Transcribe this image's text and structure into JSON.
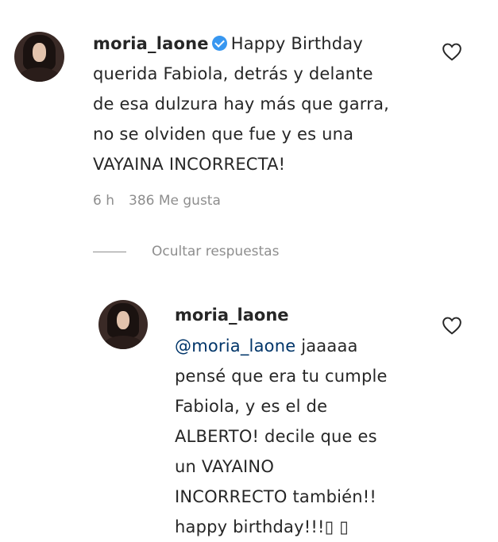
{
  "comment": {
    "username": "moria_laone",
    "text_lines": [
      "Happy Birthday",
      "querida Fabiola, detrás y delante",
      "de esa dulzura hay más que garra,",
      "no se olviden que fue y es una",
      "VAYAINA INCORRECTA!"
    ],
    "time": "6 h",
    "likes": "386 Me gusta"
  },
  "hide_replies_label": "Ocultar respuestas",
  "reply": {
    "username": "moria_laone",
    "mention": "@moria_laone",
    "text_lines": [
      " jaaaaa",
      "pensé que era tu cumple",
      "Fabiola, y es el de",
      "ALBERTO! decile que es",
      "un VAYAINO",
      "INCORRECTO también!!",
      "happy birthday!!!▯ ▯"
    ]
  }
}
